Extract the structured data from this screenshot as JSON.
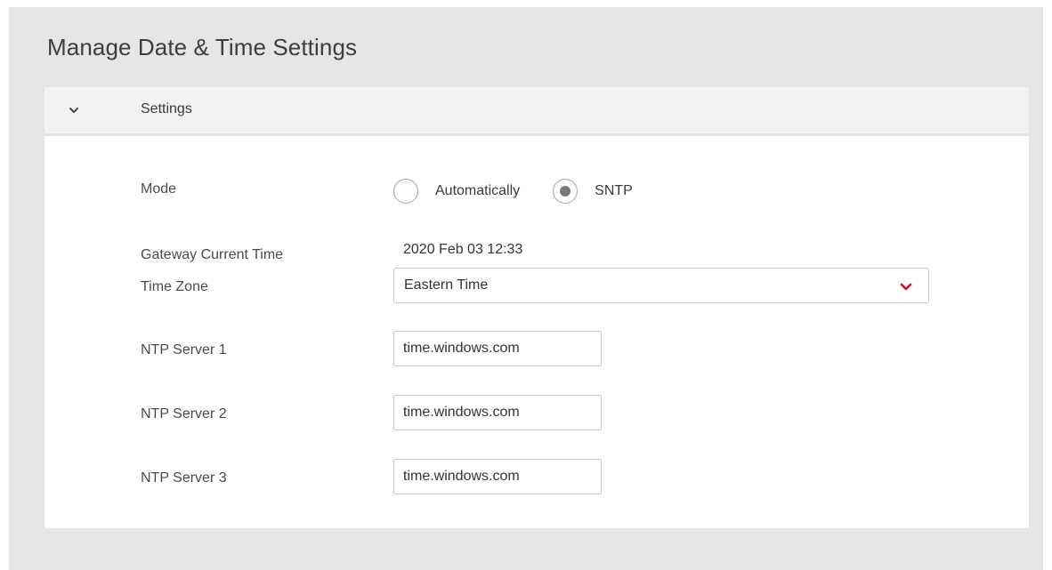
{
  "page": {
    "title": "Manage Date & Time Settings"
  },
  "accordion": {
    "label": "Settings",
    "icon": "chevron-down-icon"
  },
  "form": {
    "mode": {
      "label": "Mode",
      "options": [
        {
          "label": "Automatically",
          "selected": false
        },
        {
          "label": "SNTP",
          "selected": true
        }
      ]
    },
    "gateway_time": {
      "label": "Gateway Current Time",
      "value": "2020 Feb 03 12:33"
    },
    "time_zone": {
      "label": "Time Zone",
      "value": "Eastern Time"
    },
    "ntp_servers": [
      {
        "label": "NTP Server 1",
        "value": "time.windows.com"
      },
      {
        "label": "NTP Server 2",
        "value": "time.windows.com"
      },
      {
        "label": "NTP Server 3",
        "value": "time.windows.com"
      }
    ]
  },
  "colors": {
    "background": "#e6e6e6",
    "panel": "#ffffff",
    "header": "#f2f2f2",
    "accent": "#c8102e",
    "radio_checked": "#7a7a7a"
  }
}
